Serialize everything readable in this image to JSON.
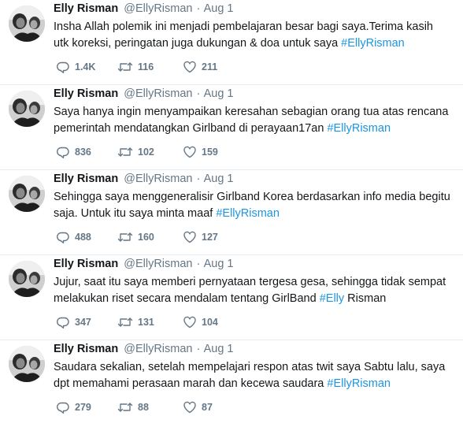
{
  "tweets": [
    {
      "name": "Elly Risman",
      "handle": "@EllyRisman",
      "separator": "·",
      "time": "Aug 1",
      "text": "Insha Allah polemik ini menjadi pembelajaran besar bagi saya.Terima kasih utk koreksi, peringatan juga dukungan & doa untuk saya ",
      "hashtag": "#EllyRisman",
      "replies": "1.4K",
      "retweets": "116",
      "likes": "211"
    },
    {
      "name": "Elly Risman",
      "handle": "@EllyRisman",
      "separator": "·",
      "time": "Aug 1",
      "text": "Saya hanya ingin menyampaikan keresahan sebagian orang tua atas rencana pemerintah mendatangkan Girlband di perayaan17an ",
      "hashtag": "#EllyRisman",
      "replies": "836",
      "retweets": "102",
      "likes": "159"
    },
    {
      "name": "Elly Risman",
      "handle": "@EllyRisman",
      "separator": "·",
      "time": "Aug 1",
      "text": "Sehingga saya menggeneralisir Girlband Korea berdasarkan info media begitu saja. Untuk itu saya minta maaf ",
      "hashtag": "#EllyRisman",
      "replies": "488",
      "retweets": "160",
      "likes": "127"
    },
    {
      "name": "Elly Risman",
      "handle": "@EllyRisman",
      "separator": "·",
      "time": "Aug 1",
      "text": "Jujur, saat itu saya memberi pernyataan  tergesa gesa, sehingga tidak sempat melakukan riset secara mendalam tentang GirlBand ",
      "hashtag": "#Elly",
      "text_after": " Risman",
      "replies": "347",
      "retweets": "131",
      "likes": "104"
    },
    {
      "name": "Elly Risman",
      "handle": "@EllyRisman",
      "separator": "·",
      "time": "Aug 1",
      "text": "Saudara sekalian, setelah mempelajari respon atas twit saya Sabtu lalu, saya dpt memahami perasaan marah dan kecewa saudara ",
      "hashtag": "#EllyRisman",
      "replies": "279",
      "retweets": "88",
      "likes": "87"
    }
  ],
  "icons": {
    "reply": "reply-icon",
    "retweet": "retweet-icon",
    "like": "heart-icon",
    "avatar": "avatar"
  },
  "colors": {
    "link": "#1b95e0",
    "muted": "#657786",
    "text": "#14171a",
    "divider": "#e6ecf0"
  }
}
